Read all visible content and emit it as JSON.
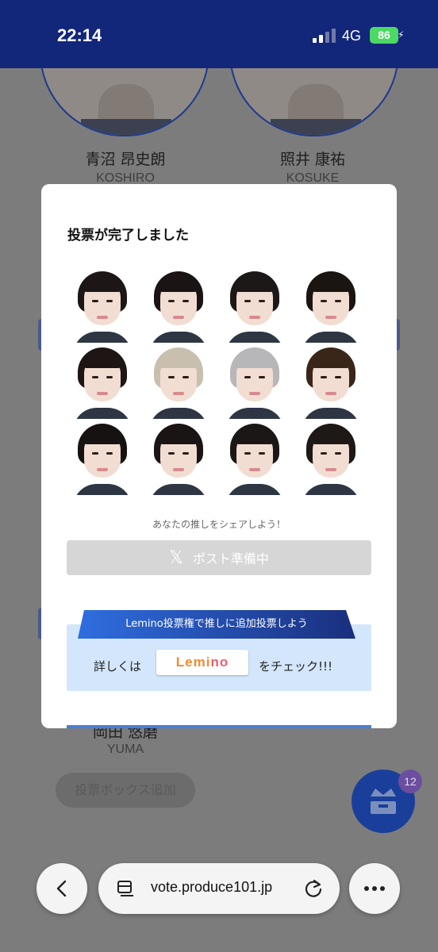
{
  "status_bar": {
    "time": "22:14",
    "network": "4G",
    "battery": "86"
  },
  "background": {
    "left_card": {
      "name": "青沼 昂史朗",
      "roman": "KOSHIRO"
    },
    "right_card": {
      "name": "照井 康祐",
      "roman": "KOSUKE"
    },
    "lower_card": {
      "name": "岡田 悠磨",
      "roman": "YUMA"
    },
    "add_box_label": "投票ボックス追加",
    "fab_badge": "12"
  },
  "modal": {
    "title": "投票が完了しました",
    "voted_faces": [
      {
        "hair": "#1c1616"
      },
      {
        "hair": "#1a1414"
      },
      {
        "hair": "#1d1818"
      },
      {
        "hair": "#1b1512"
      },
      {
        "hair": "#1e1614"
      },
      {
        "hair": "#c8bfae"
      },
      {
        "hair": "#b7b6b8"
      },
      {
        "hair": "#3a2618"
      },
      {
        "hair": "#161212"
      },
      {
        "hair": "#1a1414"
      },
      {
        "hair": "#1c1717"
      },
      {
        "hair": "#1e1816"
      }
    ],
    "share_caption": "あなたの推しをシェアしよう！",
    "post_button_label": "ポスト準備中",
    "promo_ribbon": "Lemino投票権で推しに追加投票しよう",
    "promo_prefix": "詳しくは",
    "lemino_logo_a": "Lemi",
    "lemino_logo_b": "no",
    "promo_suffix": "をチェック!!!"
  },
  "browser": {
    "url": "vote.produce101.jp"
  },
  "colors": {
    "header": "#12267a",
    "accent": "#1a3f9a",
    "promo_bg": "#d3e6fb"
  }
}
